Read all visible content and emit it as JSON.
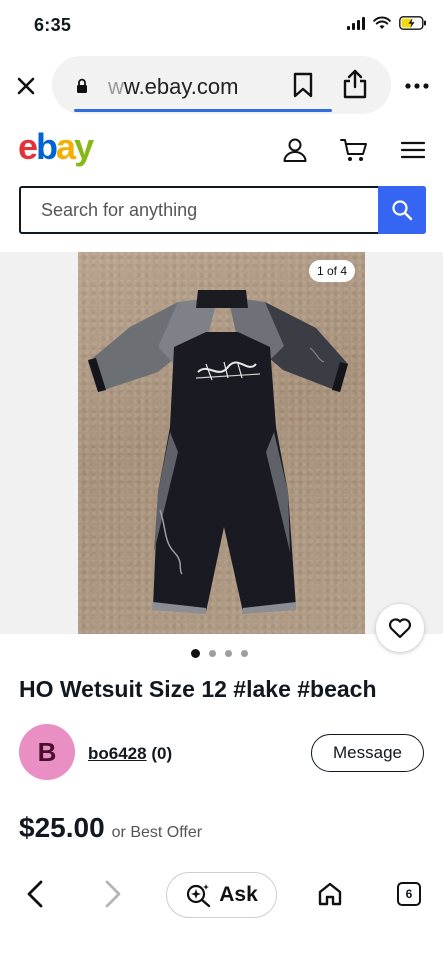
{
  "status_bar": {
    "time": "6:35",
    "icons": [
      "signal-icon",
      "wifi-icon",
      "battery-charging-icon"
    ]
  },
  "browser": {
    "url_prefix": "w",
    "url_main": "w.ebay.com",
    "icons": [
      "close-icon",
      "lock-icon",
      "bookmark-icon",
      "share-icon",
      "more-icon"
    ]
  },
  "header": {
    "logo_letters": [
      "e",
      "b",
      "a",
      "y"
    ],
    "icons": [
      "account-icon",
      "cart-icon",
      "menu-icon"
    ]
  },
  "search": {
    "placeholder": "Search for anything",
    "button_icon": "search-icon"
  },
  "gallery": {
    "counter": "1 of 4",
    "current": 1,
    "total": 4
  },
  "listing": {
    "title": "HO Wetsuit Size 12 #lake #beach",
    "price": "$25.00",
    "offer_text": "or Best Offer"
  },
  "seller": {
    "avatar_letter": "B",
    "name": "bo6428",
    "feedback": "(0)",
    "message_label": "Message"
  },
  "toolbar": {
    "ask_label": "Ask",
    "tab_count": "6",
    "icons": [
      "back-icon",
      "forward-icon",
      "sparkle-search-icon",
      "home-icon",
      "tabs-icon"
    ]
  },
  "colors": {
    "ebay_red": "#e53238",
    "ebay_blue": "#0064d2",
    "ebay_yellow": "#f5af02",
    "ebay_green": "#86b817",
    "search_button": "#3665f3",
    "avatar_bg": "#e98fc3"
  }
}
